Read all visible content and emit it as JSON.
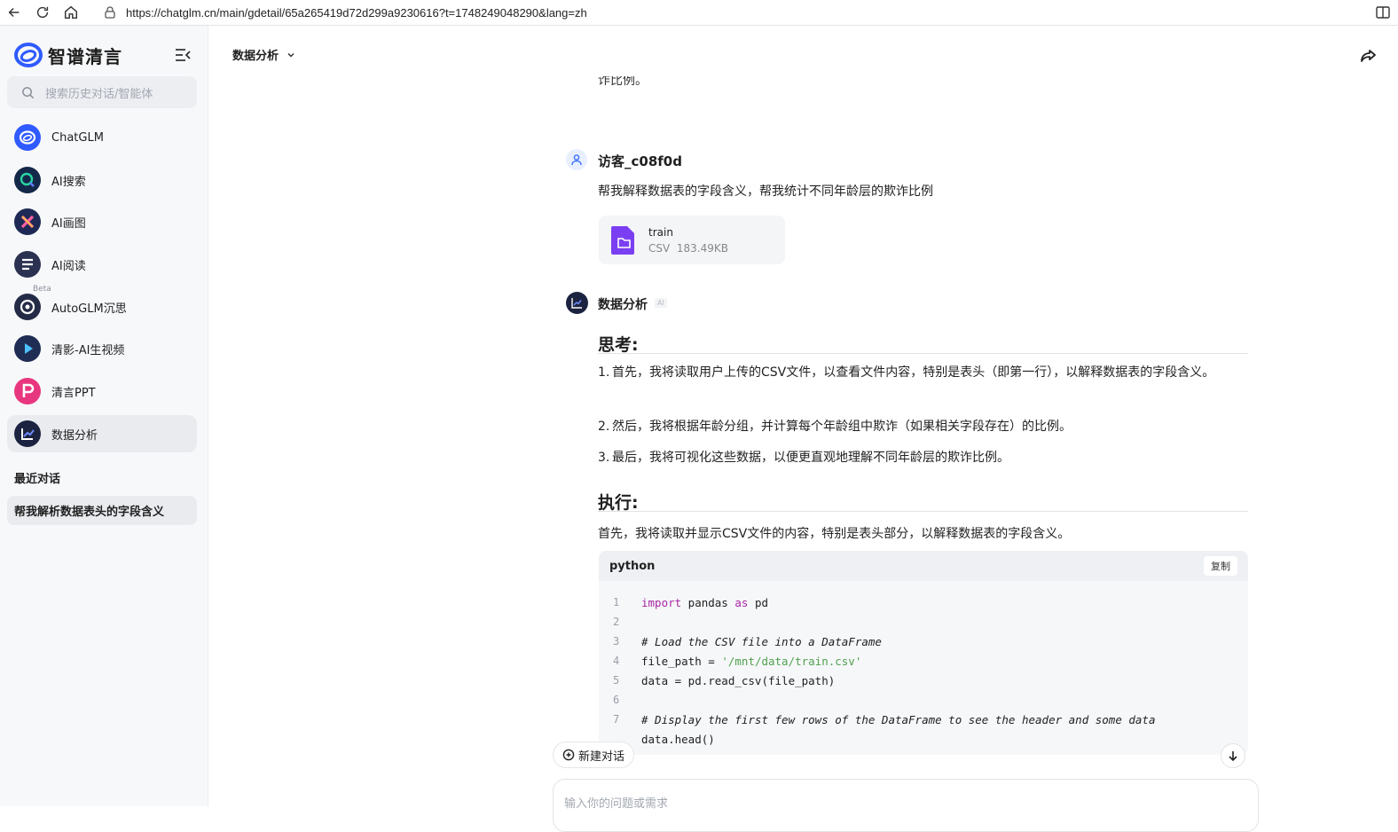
{
  "browser": {
    "url": "https://chatglm.cn/main/gdetail/65a265419d72d299a9230616?t=1748249048290&lang=zh"
  },
  "sidebar": {
    "brand": "智谱清言",
    "search_placeholder": "搜索历史对话/智能体",
    "items": [
      {
        "label": "ChatGLM",
        "icon": "chatglm-icon"
      },
      {
        "label": "AI搜索",
        "icon": "ai-search-icon"
      },
      {
        "label": "AI画图",
        "icon": "ai-paint-icon"
      },
      {
        "label": "AI阅读",
        "icon": "ai-read-icon"
      },
      {
        "label": "AutoGLM沉思",
        "icon": "autoglm-icon",
        "badge": "Beta"
      },
      {
        "label": "清影-AI生视频",
        "icon": "video-icon"
      },
      {
        "label": "清言PPT",
        "icon": "ppt-icon"
      },
      {
        "label": "数据分析",
        "icon": "data-analysis-icon",
        "active": true
      }
    ],
    "recent_heading": "最近对话",
    "recent_items": [
      "帮我解析数据表头的字段含义"
    ]
  },
  "header": {
    "title": "数据分析"
  },
  "chat": {
    "truncated_text": "诈比例。",
    "user": {
      "name": "访客_c08f0d",
      "message": "帮我解释数据表的字段含义，帮我统计不同年龄层的欺诈比例",
      "file": {
        "name": "train",
        "type": "CSV",
        "size": "183.49KB"
      }
    },
    "bot": {
      "name": "数据分析",
      "ai_tag": "AI",
      "think_heading": "思考:",
      "steps": [
        {
          "num": "1.",
          "text": "首先，我将读取用户上传的CSV文件，以查看文件内容，特别是表头（即第一行），以解释数据表的字段含义。"
        },
        {
          "num": "2.",
          "text": "然后，我将根据年龄分组，并计算每个年龄组中欺诈（如果相关字段存在）的比例。"
        },
        {
          "num": "3.",
          "text": "最后，我将可视化这些数据，以便更直观地理解不同年龄层的欺诈比例。"
        }
      ],
      "exec_heading": "执行:",
      "exec_text": "首先，我将读取并显示CSV文件的内容，特别是表头部分，以解释数据表的字段含义。",
      "code": {
        "language": "python",
        "copy_label": "复制",
        "line_numbers": [
          "1",
          "2",
          "3",
          "4",
          "5",
          "6",
          "7"
        ],
        "line8": "data.head()"
      }
    }
  },
  "bottom": {
    "new_chat": "新建对话",
    "input_placeholder": "输入你的问题或需求"
  }
}
